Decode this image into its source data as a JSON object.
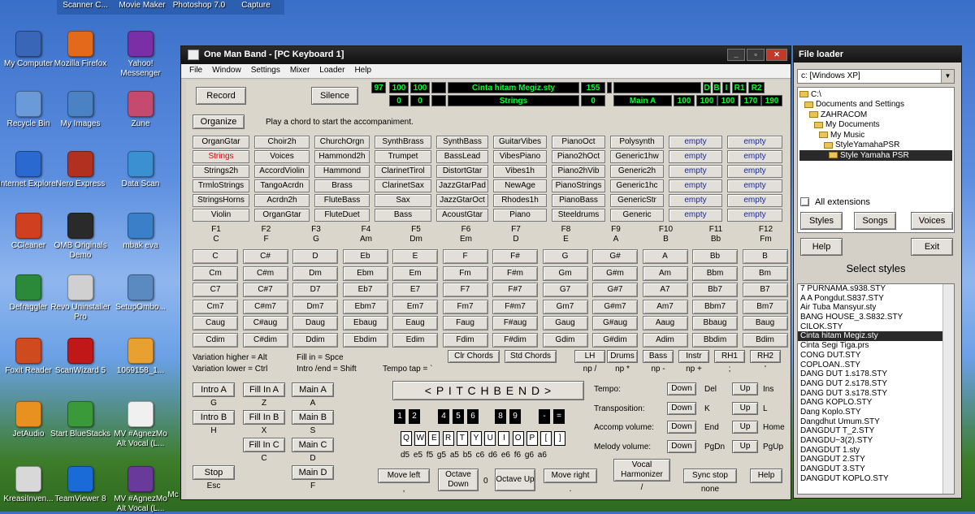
{
  "desktop": {
    "top_strip": [
      "Scanner C...",
      "Movie Maker",
      "Photoshop 7.0",
      "Capture"
    ],
    "icons": [
      {
        "label": "My Computer",
        "color": "#3a66b8"
      },
      {
        "label": "Mozilla Firefox",
        "color": "#e36a1b"
      },
      {
        "label": "Yahoo! Messenger",
        "color": "#7a2fa6"
      },
      {
        "label": "Recycle Bin",
        "color": "#6a9ad8"
      },
      {
        "label": "My Images",
        "color": "#4a82c4"
      },
      {
        "label": "Zune",
        "color": "#c44a70"
      },
      {
        "label": "Internet Explorer",
        "color": "#2a6ad0"
      },
      {
        "label": "Nero Express",
        "color": "#b23020"
      },
      {
        "label": "Data Scan",
        "color": "#3a90d0"
      },
      {
        "label": "CCleaner",
        "color": "#d04020"
      },
      {
        "label": "OMB Originals Demo",
        "color": "#2a2a2a"
      },
      {
        "label": "mbak eva",
        "color": "#3a80c8"
      },
      {
        "label": "Defraggler",
        "color": "#2a8a3a"
      },
      {
        "label": "Revo Uninstaller Pro",
        "color": "#d0d0d0"
      },
      {
        "label": "SetupOmbo...",
        "color": "#5a8ac0"
      },
      {
        "label": "Foxit Reader",
        "color": "#d04a20"
      },
      {
        "label": "ScanWizard 5",
        "color": "#c01818"
      },
      {
        "label": "1069158_1...",
        "color": "#e8a030"
      },
      {
        "label": "JetAudio",
        "color": "#e89020"
      },
      {
        "label": "Start BlueStacks",
        "color": "#3a9a3a"
      },
      {
        "label": "MV #AgnezMo Alt Vocal (L...",
        "color": "#f0f0f0"
      },
      {
        "label": "KreasiInven...",
        "color": "#d8d8d8"
      },
      {
        "label": "TeamViewer 8",
        "color": "#1a6ad8"
      },
      {
        "label": "MV #AgnezMo Alt Vocal (L...",
        "color": "#6a3a9a"
      }
    ],
    "extra": [
      "Mc"
    ]
  },
  "omb": {
    "title": "One Man Band - [PC Keyboard 1]",
    "win_buttons": [
      "_",
      "▫",
      "✕"
    ],
    "menu": [
      "File",
      "Window",
      "Settings",
      "Mixer",
      "Loader",
      "Help"
    ],
    "record": "Record",
    "silence": "Silence",
    "display": {
      "top": [
        "97",
        "100",
        "100",
        "",
        "Cinta hitam Megiz.sty",
        "155",
        "",
        "",
        "D",
        "B",
        "I",
        "R1",
        "R2"
      ],
      "bottom": [
        "0",
        "0",
        "",
        "Strings",
        "0",
        "Main A",
        "100",
        "100",
        "100",
        "170",
        "190"
      ]
    },
    "organize": "Organize",
    "hint": "Play a chord to start the accompaniment.",
    "styles": [
      [
        "OrganGtar",
        "Choir2h",
        "ChurchOrgn",
        "SynthBrass",
        "SynthBass",
        "GuitarVibes",
        "PianoOct",
        "Polysynth",
        "empty",
        "empty"
      ],
      [
        "Strings",
        "Voices",
        "Hammond2h",
        "Trumpet",
        "BassLead",
        "VibesPiano",
        "Piano2hOct",
        "Generic1hw",
        "empty",
        "empty"
      ],
      [
        "Strings2h",
        "AccordViolin",
        "Hammond",
        "ClarinetTirol",
        "DistortGtar",
        "Vibes1h",
        "Piano2hVib",
        "Generic2h",
        "empty",
        "empty"
      ],
      [
        "TrmloStrings",
        "TangoAcrdn",
        "Brass",
        "ClarinetSax",
        "JazzGtarPad",
        "NewAge",
        "PianoStrings",
        "Generic1hc",
        "empty",
        "empty"
      ],
      [
        "StringsHorns",
        "Acrdn2h",
        "FluteBass",
        "Sax",
        "JazzGtarOct",
        "Rhodes1h",
        "PianoBass",
        "GenericStr",
        "empty",
        "empty"
      ],
      [
        "Violin",
        "OrganGtar",
        "FluteDuet",
        "Bass",
        "AcoustGtar",
        "Piano",
        "Steeldrums",
        "Generic",
        "empty",
        "empty"
      ]
    ],
    "fkeys": [
      [
        "F1",
        "C"
      ],
      [
        "F2",
        "F"
      ],
      [
        "F3",
        "G"
      ],
      [
        "F4",
        "Am"
      ],
      [
        "F5",
        "Dm"
      ],
      [
        "F6",
        "Em"
      ],
      [
        "F7",
        "D"
      ],
      [
        "F8",
        "E"
      ],
      [
        "F9",
        "A"
      ],
      [
        "F10",
        "B"
      ],
      [
        "F11",
        "Bb"
      ],
      [
        "F12",
        "Fm"
      ]
    ],
    "chords": [
      [
        "C",
        "C#",
        "D",
        "Eb",
        "E",
        "F",
        "F#",
        "G",
        "G#",
        "A",
        "Bb",
        "B"
      ],
      [
        "Cm",
        "C#m",
        "Dm",
        "Ebm",
        "Em",
        "Fm",
        "F#m",
        "Gm",
        "G#m",
        "Am",
        "Bbm",
        "Bm"
      ],
      [
        "C7",
        "C#7",
        "D7",
        "Eb7",
        "E7",
        "F7",
        "F#7",
        "G7",
        "G#7",
        "A7",
        "Bb7",
        "B7"
      ],
      [
        "Cm7",
        "C#m7",
        "Dm7",
        "Ebm7",
        "Em7",
        "Fm7",
        "F#m7",
        "Gm7",
        "G#m7",
        "Am7",
        "Bbm7",
        "Bm7"
      ],
      [
        "Caug",
        "C#aug",
        "Daug",
        "Ebaug",
        "Eaug",
        "Faug",
        "F#aug",
        "Gaug",
        "G#aug",
        "Aaug",
        "Bbaug",
        "Baug"
      ],
      [
        "Cdim",
        "C#dim",
        "Ddim",
        "Ebdim",
        "Edim",
        "Fdim",
        "F#dim",
        "Gdim",
        "G#dim",
        "Adim",
        "Bbdim",
        "Bdim"
      ]
    ],
    "info": {
      "var_hi": "Variation higher = Alt",
      "var_lo": "Variation lower = Ctrl",
      "fill_in": "Fill in = Spce",
      "intro_end": "Intro /end = Shift",
      "tempo_tap": "Tempo tap = `"
    },
    "clr_chords": "Clr Chords",
    "std_chords": "Std Chords",
    "track_btns": [
      [
        "LH",
        "np /"
      ],
      [
        "Drums",
        "np *"
      ],
      [
        "Bass",
        "np -"
      ],
      [
        "Instr",
        "np +"
      ],
      [
        "RH1",
        ";"
      ],
      [
        "RH2",
        "'"
      ]
    ],
    "sections": [
      [
        "Intro A",
        "G"
      ],
      [
        "Fill In A",
        "Z"
      ],
      [
        "Main A",
        "A"
      ],
      [
        "Intro B",
        "H"
      ],
      [
        "Fill In B",
        "X"
      ],
      [
        "Main B",
        "S"
      ],
      [
        "Fill In C",
        "C"
      ],
      [
        "Main C",
        "D"
      ],
      [
        "Stop",
        "Esc"
      ],
      [
        "Main D",
        "F"
      ]
    ],
    "pitchbend": "< P I T C H B E N D >",
    "black_keys": [
      "1",
      "2",
      "4",
      "5",
      "6",
      "8",
      "9",
      "-",
      "="
    ],
    "white_keys": [
      "Q",
      "W",
      "E",
      "R",
      "T",
      "Y",
      "U",
      "I",
      "O",
      "P",
      "[",
      "]"
    ],
    "notes": "d5 e5 f5 g5 a5 b5 c6 d6 e6 f6 g6 a6",
    "controls": [
      {
        "label": "Tempo:",
        "down": "Down",
        "dk": "Del",
        "up": "Up",
        "uk": "Ins"
      },
      {
        "label": "Transposition:",
        "down": "Down",
        "dk": "K",
        "up": "Up",
        "uk": "L"
      },
      {
        "label": "Accomp volume:",
        "down": "Down",
        "dk": "End",
        "up": "Up",
        "uk": "Home"
      },
      {
        "label": "Melody volume:",
        "down": "Down",
        "dk": "PgDn",
        "up": "Up",
        "uk": "PgUp"
      }
    ],
    "move_left": "Move left",
    "move_left_key": ",",
    "oct_down": "Octave Down",
    "oct_zero": "0",
    "oct_up": "Octave Up",
    "move_right": "Move right",
    "move_right_key": ".",
    "vocal": "Vocal Harmonizer",
    "vocal_key": "/",
    "sync": "Sync stop",
    "sync_key": "none",
    "help": "Help"
  },
  "loader": {
    "title": "File loader",
    "drive": "c: [Windows XP]",
    "tree": [
      "C:\\",
      "Documents and Settings",
      "ZAHRACOM",
      "My Documents",
      "My Music",
      "StyleYamahaPSR",
      "Style Yamaha PSR"
    ],
    "all_ext": "All extensions",
    "buttons": [
      "Styles",
      "Songs",
      "Voices",
      "Help",
      "Exit"
    ],
    "select_label": "Select styles",
    "files": [
      "7 PURNAMA.s938.STY",
      "A A Pongdut.S837.STY",
      "Air Tuba Mansyur.sty",
      "BANG HOUSE_3.S832.STY",
      "CILOK.STY",
      "Cinta hitam Megiz.sty",
      "Cinta Segi Tiga.prs",
      "CONG DUT.STY",
      "COPLOAN..STY",
      "DANG DUT 1.s178.STY",
      "DANG DUT 2.s178.STY",
      "DANG DUT 3.s178.STY",
      "DANG KOPLO.STY",
      "Dang Koplo.STY",
      "Dangdhut Umum.STY",
      "DANGDUT 2.STY",
      "DANGDU~3(2).STY",
      "DANGDUT 1.sty",
      "DANGDUT 2.STY",
      "DANGDUT 3.STY",
      "DANGDUT KOPLO.STY"
    ],
    "selected_file": "Cinta hitam Megiz.sty",
    "files_fixed": [
      "7 PURNAMA.s938.STY",
      "A A Pongdut.S837.STY",
      "Air Tuba Mansyur.sty",
      "BANG HOUSE_3.S832.STY",
      "CILOK.STY",
      "Cinta hitam Megiz.sty",
      "Cinta Segi Tiga.prs",
      "CONG DUT.STY",
      "COPLOAN..STY",
      "DANG DUT 1.s178.STY",
      "DANG DUT 2.s178.STY",
      "DANG DUT 3.s178.STY",
      "DANG KOPLO.STY",
      "Dang Koplo.STY",
      "Dangdhut Umum.STY",
      "DANGDUT T_2.STY",
      "DANGDU~3(2).STY",
      "DANGDUT 1.sty",
      "DANGDUT 2.STY",
      "DANGDUT 3.STY",
      "DANGDUT KOPLO.STY"
    ]
  }
}
